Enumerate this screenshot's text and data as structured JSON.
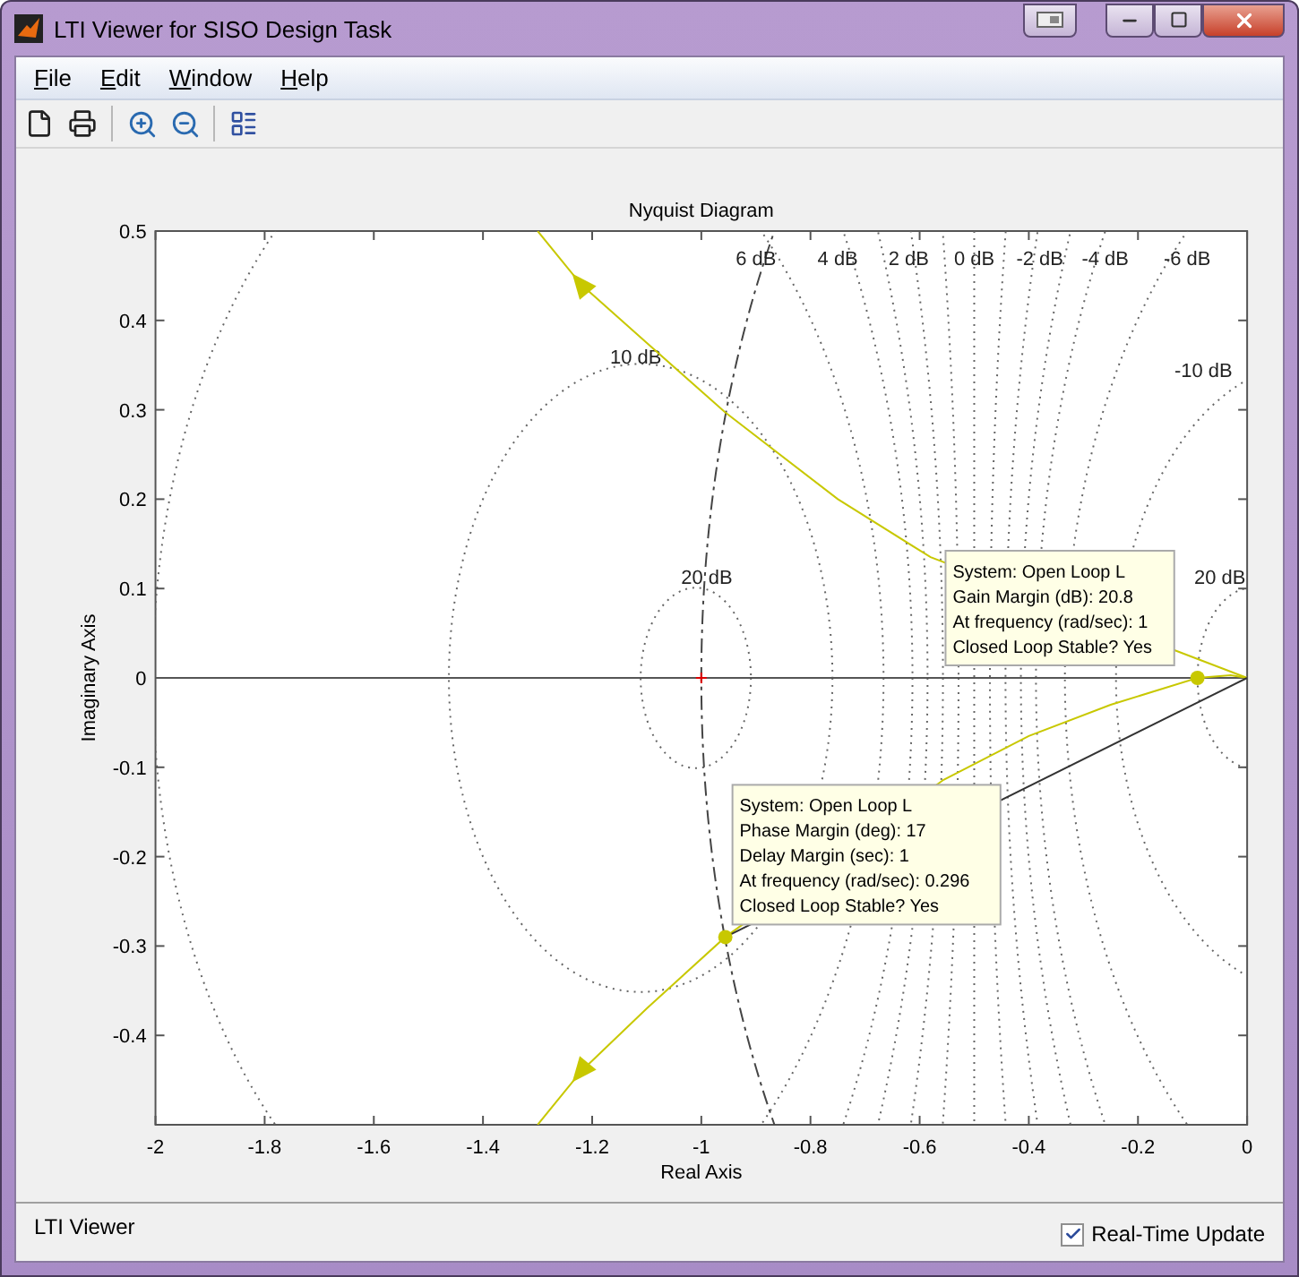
{
  "window": {
    "title": "LTI Viewer for SISO Design Task"
  },
  "menu": [
    {
      "label": "File"
    },
    {
      "label": "Edit"
    },
    {
      "label": "Window"
    },
    {
      "label": "Help"
    }
  ],
  "plot": {
    "chart_data": {
      "type": "line",
      "title": "Nyquist Diagram",
      "xlabel": "Real Axis",
      "ylabel": "Imaginary Axis",
      "xlim": [
        -2,
        0
      ],
      "ylim": [
        -0.5,
        0.5
      ],
      "xticks": [
        -2,
        -1.8,
        -1.6,
        -1.4,
        -1.2,
        -1,
        -0.8,
        -0.6,
        -0.4,
        -0.2,
        0
      ],
      "yticks": [
        -0.4,
        -0.3,
        -0.2,
        -0.1,
        0,
        0.1,
        0.2,
        0.3,
        0.4,
        0.5
      ],
      "series": [
        {
          "color": "#c8c800",
          "x": [
            -1.3,
            -1.22,
            -1.1,
            -0.956,
            -0.75,
            -0.58,
            0
          ],
          "values": [
            0.5,
            0.44,
            0.375,
            0.297,
            0.2,
            0.135,
            0
          ]
        },
        {
          "color": "#c8c800",
          "x": [
            -1.3,
            -1.22,
            -1.1,
            -0.956,
            -0.556,
            -0.4,
            -0.25,
            -0.091,
            -0.03,
            0
          ],
          "values": [
            -0.5,
            -0.44,
            -0.37,
            -0.29,
            -0.114,
            -0.065,
            -0.03,
            0,
            0.003,
            0
          ]
        },
        {
          "color": "#333333",
          "x": [
            -0.956,
            0
          ],
          "values": [
            -0.29,
            0
          ]
        }
      ],
      "ref_lines": [
        {
          "axis": "x",
          "value": -0.5
        },
        {
          "axis": "y",
          "value": 0
        }
      ]
    },
    "grid_labels": [
      "6 dB",
      "4 dB",
      "2 dB",
      "0 dB",
      "-2 dB",
      "-4 dB",
      "-6 dB",
      "10 dB",
      "-10 dB",
      "20 dB",
      "20 dB"
    ],
    "datatips": [
      {
        "lines": [
          "System: Open Loop L",
          "Gain Margin (dB): 20.8",
          "At frequency (rad/sec): 1",
          "Closed Loop Stable? Yes"
        ]
      },
      {
        "lines": [
          "System: Open Loop L",
          "Phase Margin (deg): 17",
          "Delay Margin (sec): 1",
          "At frequency (rad/sec): 0.296",
          "Closed Loop Stable? Yes"
        ]
      }
    ]
  },
  "status": {
    "text": "LTI Viewer",
    "checkbox": {
      "label": "Real-Time Update",
      "checked": true
    }
  }
}
